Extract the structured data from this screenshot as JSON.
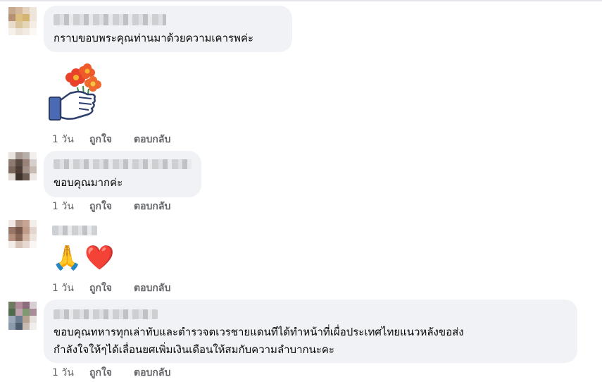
{
  "comments": [
    {
      "name_visible_fragment": "ผลา คุณละ กาญา นะ",
      "text": "กราบขอบพระคุณท่านมาด้วยความเคารพค่ะ",
      "sticker": "thumbs-up-holding-flowers-sticker",
      "time": "1 วัน",
      "like": "ถูกใจ",
      "reply": "ตอบกลับ"
    },
    {
      "text": "ขอบคุณมากค่ะ",
      "time": "1 วัน",
      "like": "ถูกใจ",
      "reply": "ตอบกลับ"
    },
    {
      "emojis": [
        "🙏",
        "❤️"
      ],
      "time": "1 วัน",
      "like": "ถูกใจ",
      "reply": "ตอบกลับ"
    },
    {
      "text_line1": "ขอบคุณทหารทุกเล่าทับและตำรวจตเวรชายแดนทีได้ทำหน้าที่เผื่อประเทศไทยแนวหลังขอส่ง",
      "text_line2": "กำลังใจให้ๆได้เลื่อนยศเพิ่มเงินเดือนให้สมกับความลำบากนะคะ",
      "time": "1 วัน",
      "like": "ถูกใจ",
      "reply": "ตอบกลับ"
    }
  ],
  "colors": {
    "bubble": "#f0f2f5",
    "action_text": "#65676b",
    "text": "#050505"
  }
}
